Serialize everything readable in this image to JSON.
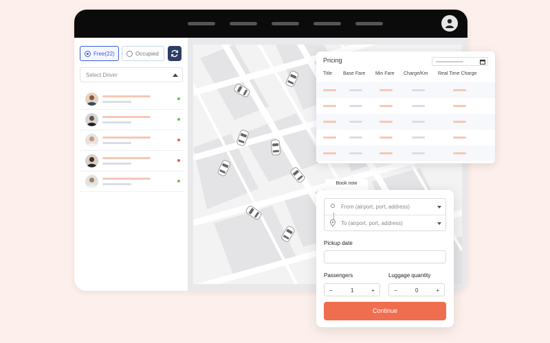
{
  "colors": {
    "accent": "#f06e50",
    "primary": "#3b5bdb",
    "online": "#6bbf59",
    "offline": "#e05d5d",
    "topbar": "#0b0b0b"
  },
  "filters": {
    "free_label": "Free(22)",
    "occupied_label": "Occupied"
  },
  "driver_select": {
    "placeholder": "Select Driver"
  },
  "drivers": [
    {
      "status": "online"
    },
    {
      "status": "online"
    },
    {
      "status": "offline"
    },
    {
      "status": "offline"
    },
    {
      "status": "online"
    }
  ],
  "pricing": {
    "title": "Pricing",
    "columns": [
      "Title",
      "Base Fare",
      "Min Fare",
      "Charge/Km",
      "Real Time Charge"
    ]
  },
  "booking": {
    "tab_label": "Book now",
    "from_placeholder": "From (airport, port, address)",
    "to_placeholder": "To (airport, port, address)",
    "pickup_label": "Pickup date",
    "passengers_label": "Passengers",
    "passengers_value": "1",
    "luggage_label": "Luggage quantity",
    "luggage_value": "0",
    "minus": "−",
    "plus": "+",
    "continue_label": "Continue"
  }
}
